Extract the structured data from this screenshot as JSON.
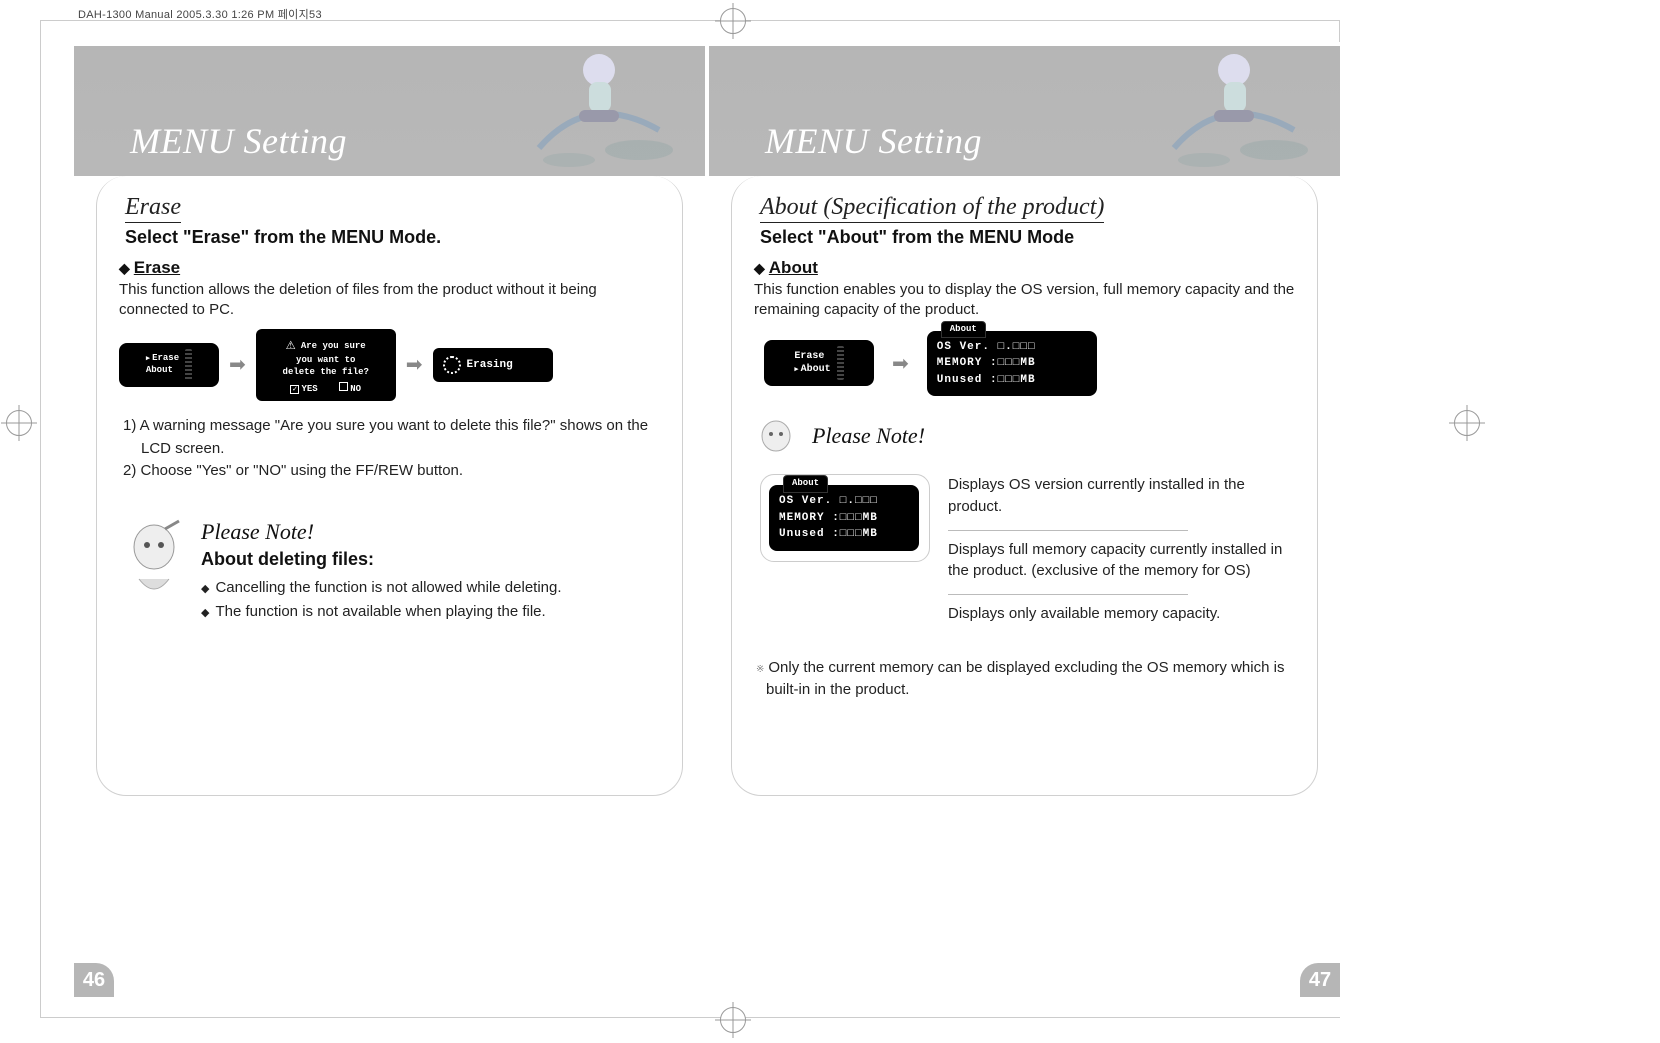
{
  "crop_header": "DAH-1300 Manual  2005.3.30 1:26 PM  페이지53",
  "band_title": "MENU Setting",
  "left": {
    "sec_title": "Erase",
    "sec_select": "Select \"Erase\" from the MENU Mode.",
    "sub_heading": "Erase",
    "body": "This function allows the deletion of files from the product without it being connected to PC.",
    "device1_line1": "Erase",
    "device1_line2": "About",
    "warn_line1": "Are you sure",
    "warn_line2": "you want to",
    "warn_line3": "delete the file?",
    "warn_tri": "?!",
    "warn_yes": "YES",
    "warn_no": "NO",
    "erasing_label": "Erasing",
    "steps": [
      "1) A warning message \"Are you sure you want to delete this file?\" shows on the LCD screen.",
      "2) Choose \"Yes\" or \"NO\" using the FF/REW button."
    ],
    "note_title": "Please Note!",
    "note_sub": "About deleting files:",
    "note_bullets": [
      "Cancelling the function is not allowed while deleting.",
      "The function is not available when playing the file."
    ],
    "page_num": "46"
  },
  "right": {
    "sec_title": "About (Specification of the product)",
    "sec_select": "Select \"About\" from the MENU Mode",
    "sub_heading": "About",
    "body": "This function enables you to display  the OS version, full memory capacity and the remaining capacity of the product.",
    "menu_line1": "Erase",
    "menu_line2": "About",
    "about_tab": "About",
    "about_l1": "OS   Ver.  □.□□□",
    "about_l2": "MEMORY :□□□MB",
    "about_l3": "Unused  :□□□MB",
    "note_title": "Please Note!",
    "detail_items": [
      "Displays OS version currently installed in the product.",
      "Displays full memory capacity currently installed in the product. (exclusive of the memory for OS)",
      "Displays only available memory capacity."
    ],
    "footnote": "Only the current memory can be displayed excluding the OS memory which is built-in in the product.",
    "page_num": "47"
  }
}
